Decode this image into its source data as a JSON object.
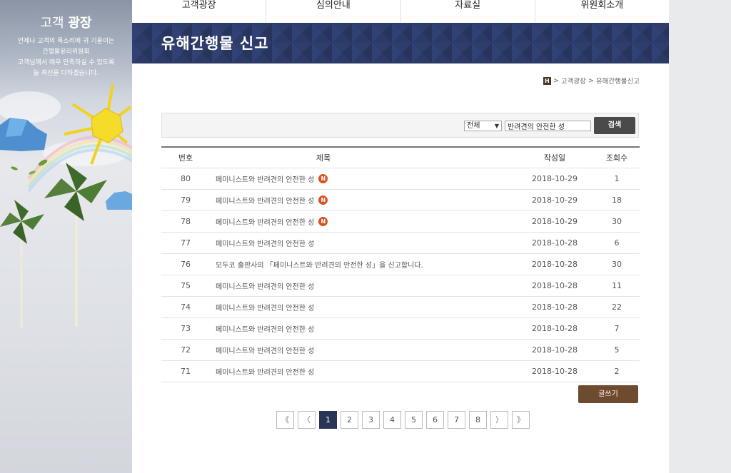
{
  "side": {
    "title_normal": "고객",
    "title_bold": "광장",
    "desc": [
      "언제나 고객의 목소리에 귀 기울이는",
      "간행물윤리위원회",
      "고객님께서 매우 만족하실 수 있도록",
      "늘 최선을 다하겠습니다."
    ]
  },
  "nav": [
    "고객광장",
    "심의안내",
    "자료실",
    "위원회소개"
  ],
  "banner_title": "유해간행물 신고",
  "breadcrumb": {
    "home_icon": "H",
    "items": [
      "고객광장",
      "유해간행물신고"
    ]
  },
  "search": {
    "scope": "전체",
    "value": "반려견의 안전한 성",
    "button": "검색"
  },
  "table": {
    "headers": {
      "num": "번호",
      "title": "제목",
      "date": "작성일",
      "views": "조회수"
    },
    "new_badge": "N",
    "rows": [
      {
        "num": "80",
        "title": "페미니스트와 반려견의 안전한 성",
        "is_new": true,
        "date": "2018-10-29",
        "views": "1"
      },
      {
        "num": "79",
        "title": "페미니스트와 반려견의 안전한 성",
        "is_new": true,
        "date": "2018-10-29",
        "views": "18"
      },
      {
        "num": "78",
        "title": "페미니스트와 반려견의 안전한 성",
        "is_new": true,
        "date": "2018-10-29",
        "views": "30"
      },
      {
        "num": "77",
        "title": "페미니스트와 반려견의 안전한 성",
        "is_new": false,
        "date": "2018-10-28",
        "views": "6"
      },
      {
        "num": "76",
        "title": "모두코 출판사의 「페미니스트와 반려견의 안전한 성」을 신고합니다.",
        "is_new": false,
        "date": "2018-10-28",
        "views": "30"
      },
      {
        "num": "75",
        "title": "페미니스트와 반려견의 안전한 성",
        "is_new": false,
        "date": "2018-10-28",
        "views": "11"
      },
      {
        "num": "74",
        "title": "페미니스트와 반려견의 안전한 성",
        "is_new": false,
        "date": "2018-10-28",
        "views": "22"
      },
      {
        "num": "73",
        "title": "페미니스트와 반려견의 안전한 성",
        "is_new": false,
        "date": "2018-10-28",
        "views": "7"
      },
      {
        "num": "72",
        "title": "페미니스트와 반려견의 안전한 성",
        "is_new": false,
        "date": "2018-10-28",
        "views": "5"
      },
      {
        "num": "71",
        "title": "페미니스트와 반려견의 안전한 성",
        "is_new": false,
        "date": "2018-10-28",
        "views": "2"
      }
    ]
  },
  "write_button": "글쓰기",
  "pagination": {
    "first": "《",
    "prev": "〈",
    "pages": [
      "1",
      "2",
      "3",
      "4",
      "5",
      "6",
      "7",
      "8"
    ],
    "current": "1",
    "next": "〉",
    "last": "》"
  },
  "colors": {
    "banner": "#2b3a66",
    "new_badge": "#d6541f",
    "write_button": "#6e4a2e",
    "active_page": "#283656"
  }
}
